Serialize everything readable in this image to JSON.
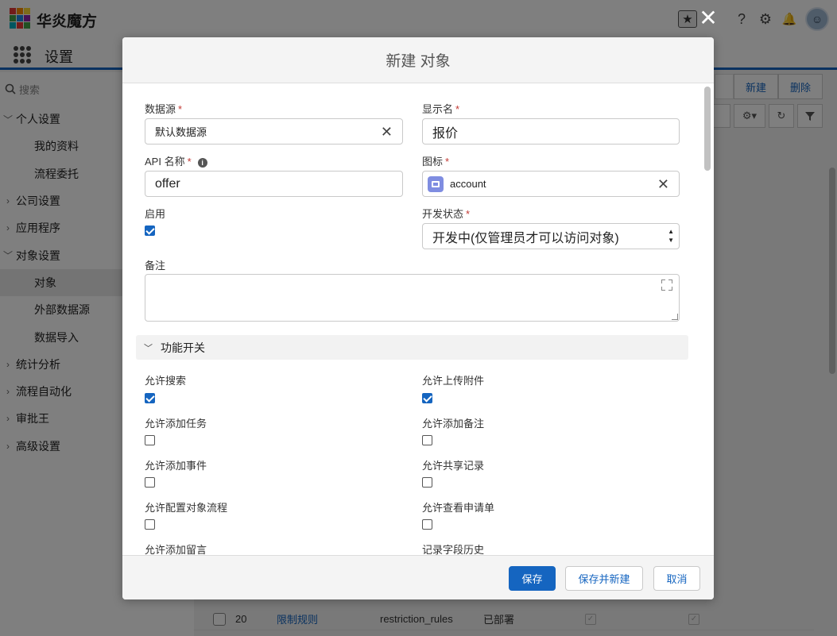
{
  "app": {
    "brand": "华炎魔方",
    "section_title": "设置",
    "logo_colors": [
      "#e53935",
      "#fb8c00",
      "#fdd835",
      "#43a047",
      "#1e88e5",
      "#8e24aa",
      "#00acc1",
      "#e53935",
      "#43a047"
    ]
  },
  "topbar": {
    "star_icon": "★",
    "help_icon": "?",
    "gear_icon": "⚙",
    "bell_icon": "🔔",
    "avatar_glyph": "☺"
  },
  "sidebar": {
    "search_placeholder": "搜索",
    "items": [
      {
        "label": "个人设置",
        "chevron": "﹀"
      },
      {
        "label": "我的资料"
      },
      {
        "label": "流程委托"
      },
      {
        "label": "公司设置",
        "chevron": "›"
      },
      {
        "label": "应用程序",
        "chevron": "›"
      },
      {
        "label": "对象设置",
        "chevron": "﹀"
      },
      {
        "label": "对象"
      },
      {
        "label": "外部数据源"
      },
      {
        "label": "数据导入"
      },
      {
        "label": "统计分析",
        "chevron": "›"
      },
      {
        "label": "流程自动化",
        "chevron": "›"
      },
      {
        "label": "审批王",
        "chevron": "›"
      },
      {
        "label": "高级设置",
        "chevron": "›"
      }
    ]
  },
  "background": {
    "btn_new": "新建",
    "btn_delete": "删除",
    "row": {
      "num": "20",
      "name": "限制规则",
      "api": "restriction_rules",
      "status": "已部署"
    }
  },
  "modal": {
    "title": "新建 对象",
    "required_mark": "*",
    "datasource": {
      "label": "数据源",
      "value": "默认数据源"
    },
    "display_name": {
      "label": "显示名",
      "value": "报价"
    },
    "api_name": {
      "label": "API 名称",
      "value": "offer"
    },
    "icon": {
      "label": "图标",
      "value": "account"
    },
    "enabled": {
      "label": "启用",
      "checked": true
    },
    "dev_status": {
      "label": "开发状态",
      "value": "开发中(仅管理员才可以访问对象)"
    },
    "notes": {
      "label": "备注",
      "value": ""
    },
    "section": {
      "label": "功能开关"
    },
    "switches": [
      {
        "label": "允许搜索",
        "checked": true
      },
      {
        "label": "允许上传附件",
        "checked": true
      },
      {
        "label": "允许添加任务",
        "checked": false
      },
      {
        "label": "允许添加备注",
        "checked": false
      },
      {
        "label": "允许添加事件",
        "checked": false
      },
      {
        "label": "允许共享记录",
        "checked": false
      },
      {
        "label": "允许配置对象流程",
        "checked": false
      },
      {
        "label": "允许查看申请单",
        "checked": false
      },
      {
        "label": "允许添加留言"
      },
      {
        "label": "记录字段历史"
      }
    ],
    "footer": {
      "save": "保存",
      "save_new": "保存并新建",
      "cancel": "取消"
    }
  }
}
